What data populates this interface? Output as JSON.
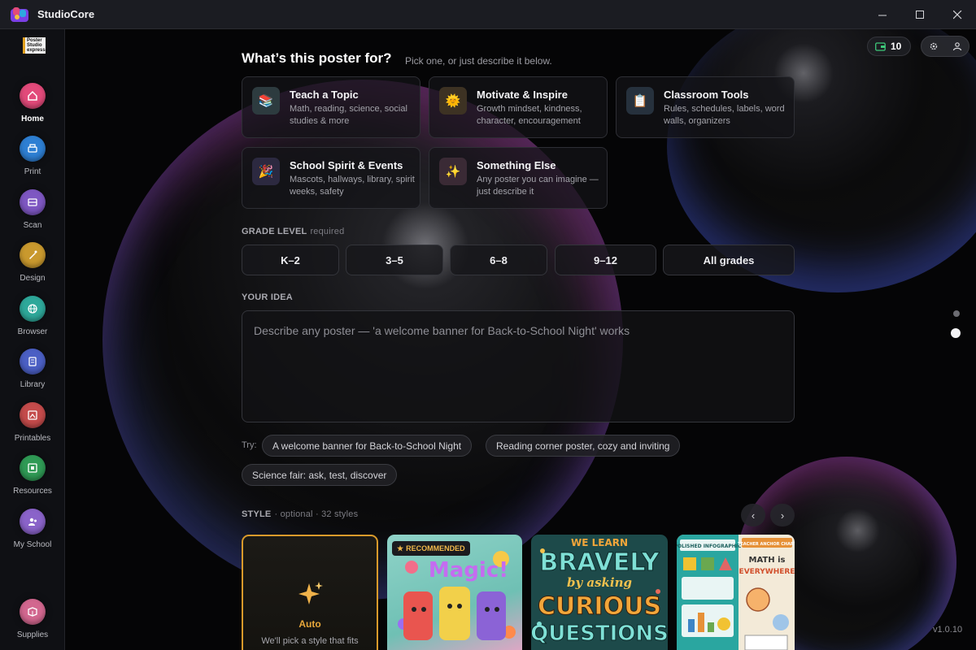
{
  "window": {
    "title": "StudioCore"
  },
  "sidebar": {
    "logo_text": "Poster Studio Express",
    "items": [
      {
        "label": "Home",
        "icon": "home-icon",
        "color": "#e24a7a",
        "active": true
      },
      {
        "label": "Print",
        "icon": "printer-icon",
        "color": "#2e7fd3"
      },
      {
        "label": "Scan",
        "icon": "scan-icon",
        "color": "#7e57c2"
      },
      {
        "label": "Design",
        "icon": "paint-icon",
        "color": "#c9992e"
      },
      {
        "label": "Browser",
        "icon": "globe-icon",
        "color": "#2ea89a"
      },
      {
        "label": "Library",
        "icon": "book-icon",
        "color": "#4b5fc4"
      },
      {
        "label": "Printables",
        "icon": "printables-icon",
        "color": "#c44b4b"
      },
      {
        "label": "Resources",
        "icon": "resources-icon",
        "color": "#2f9a55"
      },
      {
        "label": "My School",
        "icon": "school-icon",
        "color": "#8a63c9"
      },
      {
        "label": "Supplies",
        "icon": "box-icon",
        "color": "#d2678f"
      }
    ]
  },
  "header": {
    "credits": "10"
  },
  "main": {
    "heading": "What’s this poster for?",
    "heading_sub": "Pick one, or just describe it below.",
    "purposes": [
      {
        "title": "Teach a Topic",
        "desc": "Math, reading, science, social studies & more",
        "icon": "📚",
        "icon_bg": "#2d3b3f"
      },
      {
        "title": "Motivate & Inspire",
        "desc": "Growth mindset, kindness, character, encouragement",
        "icon": "🌞",
        "icon_bg": "#3d3223"
      },
      {
        "title": "Classroom Tools",
        "desc": "Rules, schedules, labels, word walls, organizers",
        "icon": "📋",
        "icon_bg": "#26313d"
      },
      {
        "title": "School Spirit & Events",
        "desc": "Mascots, hallways, library, spirit weeks, safety",
        "icon": "🎉",
        "icon_bg": "#2c2940"
      },
      {
        "title": "Something Else",
        "desc": "Any poster you can imagine — just describe it",
        "icon": "✨",
        "icon_bg": "#3a2a35"
      }
    ],
    "grade_label": "GRADE LEVEL",
    "grade_required": "required",
    "grades": [
      "K–2",
      "3–5",
      "6–8",
      "9–12",
      "All grades"
    ],
    "idea_label": "YOUR IDEA",
    "idea_placeholder": "Describe any poster — 'a welcome banner for Back-to-School Night' works",
    "try_label": "Try:",
    "suggestions": [
      "A welcome banner for Back-to-School Night",
      "Reading corner poster, cozy and inviting",
      "Science fair: ask, test, discover"
    ],
    "style_label": "STYLE",
    "style_sub": "· optional · 32 styles",
    "auto_card": {
      "title": "Auto",
      "desc": "We'll pick a style that fits"
    },
    "recommended_badge": "RECOMMENDED",
    "style_cards": [
      {
        "name": "clay-art-style",
        "text": "Magic!"
      },
      {
        "name": "bold-lettering-style",
        "text": "WE LEARN BRAVELY by asking CURIOUS QUESTIONS"
      },
      {
        "name": "polished-infographic-style",
        "text": "POLISHED INFOGRAPHIC"
      },
      {
        "name": "anchor-chart-style",
        "text": "TEACHER ANCHOR CHART · MATH is EVERYWHERE"
      }
    ]
  },
  "version": "v1.0.10"
}
